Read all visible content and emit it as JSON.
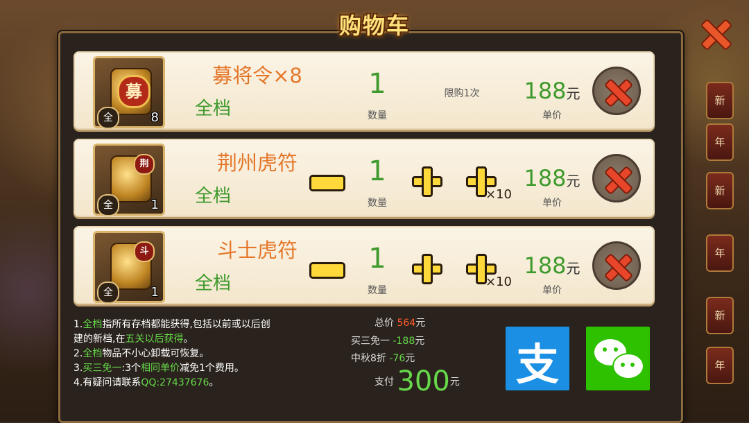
{
  "title": "购物车",
  "background": {
    "strips": [
      "新",
      "年",
      "新",
      "年",
      "新",
      "年"
    ]
  },
  "items": [
    {
      "name": "募将令×8",
      "tier": "全档",
      "quantity": "1",
      "quantity_label": "数量",
      "limit": "限购1次",
      "price": "188",
      "price_unit": "元",
      "price_label": "单价",
      "thumb_seal": "募",
      "thumb_tier": "全",
      "thumb_count": "8",
      "adjustable": false
    },
    {
      "name": "荆州虎符",
      "tier": "全档",
      "quantity": "1",
      "quantity_label": "数量",
      "limit": "",
      "price": "188",
      "price_unit": "元",
      "price_label": "单价",
      "thumb_seal": "荆",
      "thumb_tier": "全",
      "thumb_count": "1",
      "adjustable": true,
      "plus10_label": "×10"
    },
    {
      "name": "斗士虎符",
      "tier": "全档",
      "quantity": "1",
      "quantity_label": "数量",
      "limit": "",
      "price": "188",
      "price_unit": "元",
      "price_label": "单价",
      "thumb_seal": "斗",
      "thumb_tier": "全",
      "thumb_count": "1",
      "adjustable": true,
      "plus10_label": "×10"
    }
  ],
  "notes": [
    {
      "parts": [
        {
          "t": "1.",
          "g": false
        },
        {
          "t": "全档",
          "g": true
        },
        {
          "t": "指所有存档都能获得,包括以前或以后创",
          "g": false
        }
      ]
    },
    {
      "parts": [
        {
          "t": "建的新档,在",
          "g": false
        },
        {
          "t": "五关以后获得",
          "g": true
        },
        {
          "t": "。",
          "g": false
        }
      ]
    },
    {
      "parts": [
        {
          "t": "2.",
          "g": false
        },
        {
          "t": "全档",
          "g": true
        },
        {
          "t": "物品不小心卸载可恢复。",
          "g": false
        }
      ]
    },
    {
      "parts": [
        {
          "t": "3.",
          "g": false
        },
        {
          "t": "买三免一",
          "g": true
        },
        {
          "t": ":3个",
          "g": false
        },
        {
          "t": "相同单价",
          "g": true
        },
        {
          "t": "减免1个费用。",
          "g": false
        }
      ]
    },
    {
      "parts": [
        {
          "t": "4.有疑问请联系",
          "g": false
        },
        {
          "t": "QQ:27437676",
          "g": true
        },
        {
          "t": "。",
          "g": false
        }
      ]
    }
  ],
  "summary": {
    "total_label": "总价",
    "total_value": "564",
    "total_unit": "元",
    "discount1_label": "买三免一",
    "discount1_value": "-188",
    "discount1_unit": "元",
    "discount2_label": "中秋8折",
    "discount2_value": "-76",
    "discount2_unit": "元",
    "pay_label": "支付",
    "pay_value": "300",
    "pay_unit": "元"
  },
  "payment": {
    "alipay_glyph": "支",
    "alipay_color": "#1a8fe3",
    "wechat_color": "#2dc100"
  },
  "colors": {
    "green": "#3f9a2d",
    "orange": "#e4772a",
    "title": "#ffe27a",
    "red": "#ff5a2a"
  }
}
